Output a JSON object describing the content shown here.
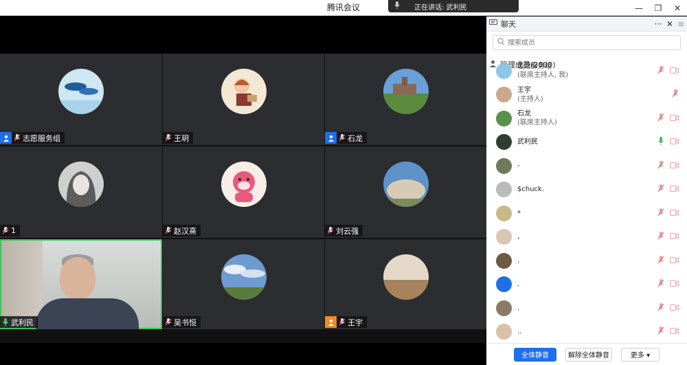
{
  "window": {
    "title": "腾讯会议",
    "controls": {
      "minimize": "—",
      "restore": "❐",
      "close": "✕"
    }
  },
  "speaking": {
    "label": "正在讲话: 武利民"
  },
  "tiles": [
    {
      "name": "志愿服务组",
      "badge": "host-blue",
      "avatar": "whales"
    },
    {
      "name": "王玥",
      "badge": "none",
      "avatar": "girl-drawing"
    },
    {
      "name": "石龙",
      "badge": "host-blue",
      "avatar": "campus"
    },
    {
      "name": "1",
      "badge": "none",
      "avatar": "anime"
    },
    {
      "name": "赵汉熹",
      "badge": "none",
      "avatar": "bear"
    },
    {
      "name": "刘云强",
      "badge": "none",
      "avatar": "rock"
    },
    {
      "name": "武利民",
      "badge": "none",
      "avatar": "webcam",
      "mic_active": true
    },
    {
      "name": "吴书恒",
      "badge": "none",
      "avatar": "sky"
    },
    {
      "name": "王宇",
      "badge": "host-orange",
      "avatar": "field"
    }
  ],
  "panel": {
    "tab_chat": "聊天",
    "tab_members": "管理成员(2000)",
    "more_icon": "···",
    "close_icon": "✕",
    "menu_icon": "≡",
    "search_placeholder": "搜索成员",
    "members": [
      {
        "name": "志愿服务组",
        "role": "(联席主持人, 我)",
        "avatar": "#8fc6e8",
        "camera": true
      },
      {
        "name": "王宇",
        "role": "(主持人)",
        "avatar": "#caa88a",
        "camera": false
      },
      {
        "name": "石龙",
        "role": "(联席主持人)",
        "avatar": "#5b8f4e",
        "camera": true
      },
      {
        "name": "武利民",
        "role": "",
        "avatar": "#2f3d33",
        "camera": true,
        "speaking": true
      },
      {
        "name": "-",
        "role": "",
        "avatar": "#6f7a5a",
        "camera": true
      },
      {
        "name": "$chuck.",
        "role": "",
        "avatar": "#b9bcb8",
        "camera": true
      },
      {
        "name": "*",
        "role": "",
        "avatar": "#c8b98a",
        "camera": true
      },
      {
        "name": ",",
        "role": "",
        "avatar": "#d8c7b4",
        "camera": true
      },
      {
        "name": ".",
        "role": "",
        "avatar": "#6e5a46",
        "camera": true
      },
      {
        "name": ".",
        "role": "",
        "avatar": "#1f6fe8",
        "camera": true
      },
      {
        "name": ".",
        "role": "",
        "avatar": "#8a7a66",
        "camera": true
      },
      {
        "name": "..",
        "role": "",
        "avatar": "#d9c0a8",
        "camera": true
      }
    ],
    "btn_mute_all": "全体静音",
    "btn_unmute_all": "解除全体静音",
    "btn_more": "更多 ▾"
  },
  "colors": {
    "accent": "#1f6fe8",
    "host_orange": "#f08a24",
    "mic_active": "#3ec35a",
    "muted": "#e06b6b",
    "tile_bg": "#2c2d30"
  }
}
